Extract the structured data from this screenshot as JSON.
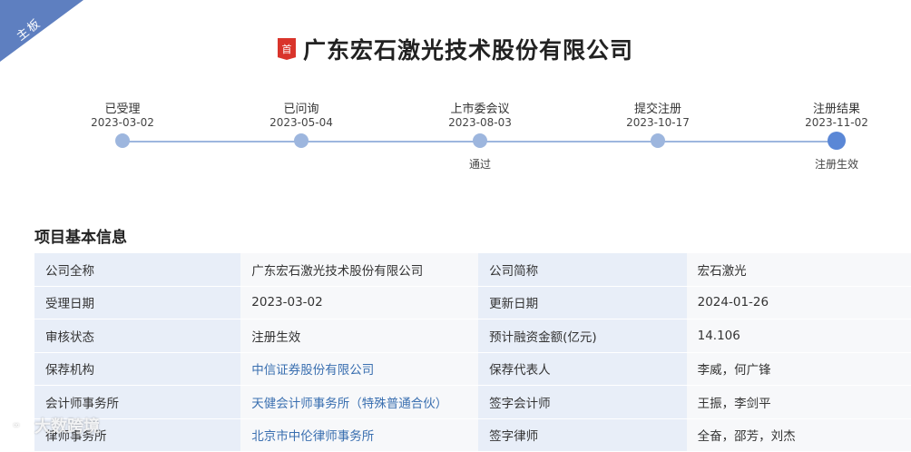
{
  "corner_label": "主板",
  "header": {
    "badge": "首",
    "company_name": "广东宏石激光技术股份有限公司"
  },
  "timeline": [
    {
      "label": "已受理",
      "date": "2023-03-02",
      "note": ""
    },
    {
      "label": "已问询",
      "date": "2023-05-04",
      "note": ""
    },
    {
      "label": "上市委会议",
      "date": "2023-08-03",
      "note": "通过"
    },
    {
      "label": "提交注册",
      "date": "2023-10-17",
      "note": ""
    },
    {
      "label": "注册结果",
      "date": "2023-11-02",
      "note": "注册生效"
    }
  ],
  "section_title": "项目基本信息",
  "info_rows": [
    {
      "k1": "公司全称",
      "v1": "广东宏石激光技术股份有限公司",
      "k2": "公司简称",
      "v2": "宏石激光"
    },
    {
      "k1": "受理日期",
      "v1": "2023-03-02",
      "k2": "更新日期",
      "v2": "2024-01-26"
    },
    {
      "k1": "审核状态",
      "v1": "注册生效",
      "k2": "预计融资金额(亿元)",
      "v2": "14.106"
    },
    {
      "k1": "保荐机构",
      "v1": "中信证券股份有限公司",
      "k2": "保荐代表人",
      "v2": "李威，何广锋"
    },
    {
      "k1": "会计师事务所",
      "v1": "天健会计师事务所（特殊普通合伙）",
      "k2": "签字会计师",
      "v2": "王振，李剑平"
    },
    {
      "k1": "律师事务所",
      "v1": "北京市中伦律师事务所",
      "k2": "签字律师",
      "v2": "全奋，邵芳，刘杰"
    }
  ],
  "watermark": "大数跨境",
  "colors": {
    "accent": "#5a87d6",
    "timeline_line": "#9db6de",
    "link": "#3a6fb0",
    "key_bg": "#e8eef8",
    "brand_red": "#d9342b"
  }
}
